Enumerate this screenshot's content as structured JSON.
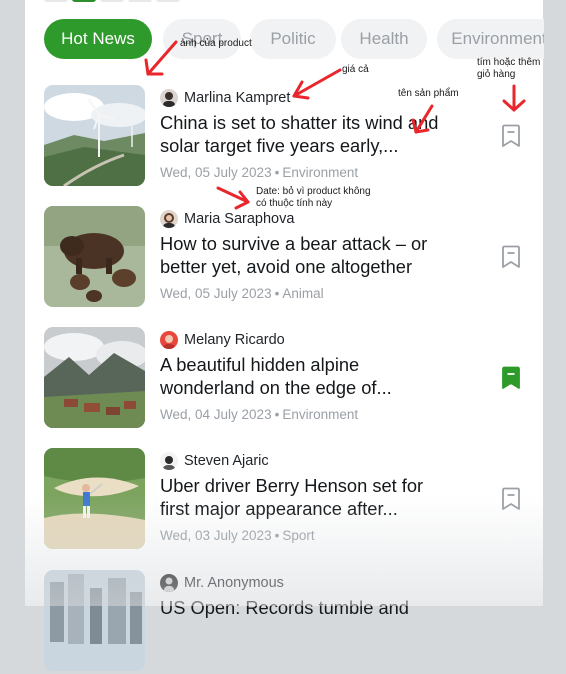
{
  "tabs": [
    {
      "label": "Hot News",
      "active": true
    },
    {
      "label": "Sport",
      "active": false
    },
    {
      "label": "Politic",
      "active": false
    },
    {
      "label": "Health",
      "active": false
    },
    {
      "label": "Environment",
      "active": false
    }
  ],
  "articles": [
    {
      "author": "Marlina Kampret",
      "title": "China is set to shatter its wind and solar target five years early,...",
      "date": "Wed, 05 July 2023",
      "category": "Environment",
      "bookmarked": false
    },
    {
      "author": "Maria Saraphova",
      "title": "How to survive a bear attack – or better yet, avoid one altogether",
      "date": "Wed, 05 July 2023",
      "category": "Animal",
      "bookmarked": false
    },
    {
      "author": "Melany Ricardo",
      "title": "A beautiful hidden alpine wonderland on the edge of...",
      "date": "Wed, 04 July 2023",
      "category": "Environment",
      "bookmarked": true
    },
    {
      "author": "Steven Ajaric",
      "title": "Uber driver Berry Henson set for first major appearance after...",
      "date": "Wed, 03 July 2023",
      "category": "Sport",
      "bookmarked": false
    },
    {
      "author": "Mr. Anonymous",
      "title": "US Open: Records tumble and",
      "date": "",
      "category": "",
      "bookmarked": false
    }
  ],
  "separator": "•",
  "annotations": {
    "image": "ảnh của product",
    "price": "giá cả",
    "product_name": "tên sản phẩm",
    "favorite_line1": "tím hoặc thêm",
    "favorite_line2": "giỏ hàng",
    "date_line1": "Date: bỏ vì product không",
    "date_line2": "có thuộc tính này"
  },
  "colors": {
    "accent": "#2e9a2b",
    "annotation_arrow": "#e8262b",
    "bookmark_idle": "#9aa0a6"
  }
}
